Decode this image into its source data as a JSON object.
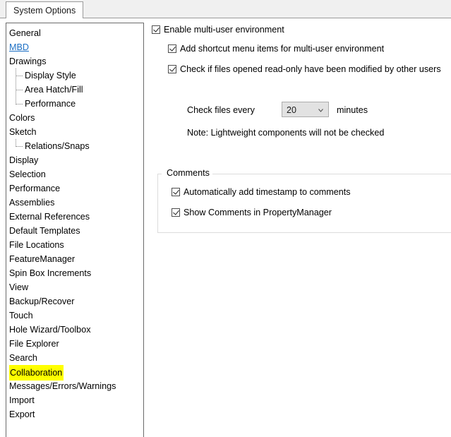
{
  "window": {
    "tab_label": "System Options"
  },
  "sidebar": {
    "items": [
      {
        "label": "General",
        "type": "item"
      },
      {
        "label": "MBD",
        "type": "link"
      },
      {
        "label": "Drawings",
        "type": "item"
      },
      {
        "label": "Display Style",
        "type": "child"
      },
      {
        "label": "Area Hatch/Fill",
        "type": "child"
      },
      {
        "label": "Performance",
        "type": "child-last"
      },
      {
        "label": "Colors",
        "type": "item"
      },
      {
        "label": "Sketch",
        "type": "item"
      },
      {
        "label": "Relations/Snaps",
        "type": "child-last"
      },
      {
        "label": "Display",
        "type": "item"
      },
      {
        "label": "Selection",
        "type": "item"
      },
      {
        "label": "Performance",
        "type": "item"
      },
      {
        "label": "Assemblies",
        "type": "item"
      },
      {
        "label": "External References",
        "type": "item"
      },
      {
        "label": "Default Templates",
        "type": "item"
      },
      {
        "label": "File Locations",
        "type": "item"
      },
      {
        "label": "FeatureManager",
        "type": "item"
      },
      {
        "label": "Spin Box Increments",
        "type": "item"
      },
      {
        "label": "View",
        "type": "item"
      },
      {
        "label": "Backup/Recover",
        "type": "item"
      },
      {
        "label": "Touch",
        "type": "item"
      },
      {
        "label": "Hole Wizard/Toolbox",
        "type": "item"
      },
      {
        "label": "File Explorer",
        "type": "item"
      },
      {
        "label": "Search",
        "type": "item"
      },
      {
        "label": "Collaboration",
        "type": "highlighted"
      },
      {
        "label": "Messages/Errors/Warnings",
        "type": "item"
      },
      {
        "label": "Import",
        "type": "item"
      },
      {
        "label": "Export",
        "type": "item"
      }
    ],
    "highlight_color": "#ffff00",
    "link_color": "#1c6fc4"
  },
  "main": {
    "enable_multiuser": {
      "label": "Enable multi-user environment",
      "checked": true
    },
    "add_shortcut": {
      "label": "Add shortcut menu items for multi-user environment",
      "checked": true
    },
    "check_readonly": {
      "label": "Check if files opened read-only have been modified by other users",
      "checked": true
    },
    "check_interval": {
      "prefix_label": "Check files every",
      "value": "20",
      "suffix_label": "minutes",
      "chevron_icon": "chevron-down-icon"
    },
    "note": "Note: Lightweight components will not be checked",
    "comments_group": {
      "title": "Comments",
      "auto_timestamp": {
        "label": "Automatically add timestamp to comments",
        "checked": true
      },
      "show_in_pm": {
        "label": "Show Comments in PropertyManager",
        "checked": true
      }
    }
  }
}
